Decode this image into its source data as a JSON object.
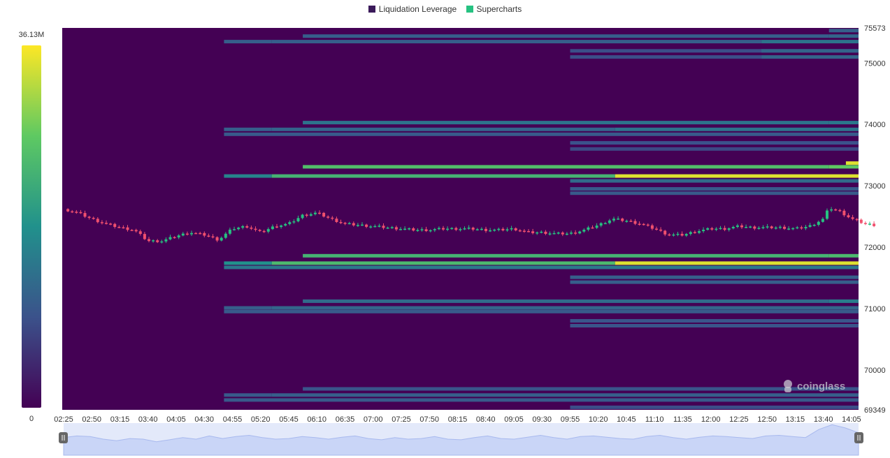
{
  "legend": {
    "items": [
      {
        "label": "Liquidation Leverage",
        "color": "#3b1a5a"
      },
      {
        "label": "Supercharts",
        "color": "#26c281"
      }
    ]
  },
  "colorbar": {
    "max_label": "36.13M",
    "min_label": "0",
    "stops": [
      "#440154",
      "#3b528b",
      "#21918c",
      "#5ec962",
      "#fde725"
    ]
  },
  "watermark": {
    "text": "coinglass",
    "icon": "coinglass-logo-icon"
  },
  "chart_data": {
    "type": "heatmap",
    "x_ticks": [
      "02:25",
      "02:50",
      "03:15",
      "03:40",
      "04:05",
      "04:30",
      "04:55",
      "05:20",
      "05:45",
      "06:10",
      "06:35",
      "07:00",
      "07:25",
      "07:50",
      "08:15",
      "08:40",
      "09:05",
      "09:30",
      "09:55",
      "10:20",
      "10:45",
      "11:10",
      "11:35",
      "12:00",
      "12:25",
      "12:50",
      "13:15",
      "13:40",
      "14:05"
    ],
    "y_ticks": [
      75573,
      75000,
      74000,
      73000,
      72000,
      71000,
      70000,
      69349
    ],
    "ylim": [
      69349,
      75573
    ],
    "colorscale_range": [
      0,
      36130000
    ],
    "background_value": 0,
    "bands": [
      {
        "price": 75530,
        "segments": [
          [
            27.2,
            28.8,
            0.3
          ]
        ]
      },
      {
        "price": 75440,
        "segments": [
          [
            8.5,
            27.2,
            0.3
          ],
          [
            27.2,
            28.8,
            0.33
          ]
        ]
      },
      {
        "price": 75350,
        "segments": [
          [
            5.7,
            7.4,
            0.3
          ],
          [
            7.4,
            24.8,
            0.3
          ],
          [
            24.8,
            28.8,
            0.38
          ]
        ]
      },
      {
        "price": 75200,
        "segments": [
          [
            18,
            28.8,
            0.24
          ],
          [
            24.8,
            28.8,
            0.32
          ]
        ]
      },
      {
        "price": 75100,
        "segments": [
          [
            18,
            24.8,
            0.24
          ],
          [
            24.8,
            28.8,
            0.32
          ]
        ]
      },
      {
        "price": 74100,
        "segments": [
          [
            28.3,
            28.8,
            0.45
          ]
        ]
      },
      {
        "price": 74030,
        "segments": [
          [
            8.5,
            27.2,
            0.38
          ],
          [
            27.2,
            28.8,
            0.4
          ]
        ]
      },
      {
        "price": 73920,
        "segments": [
          [
            5.7,
            7.4,
            0.3
          ],
          [
            7.4,
            19.6,
            0.32
          ],
          [
            19.6,
            28.8,
            0.38
          ]
        ]
      },
      {
        "price": 73840,
        "segments": [
          [
            5.7,
            28.8,
            0.28
          ]
        ]
      },
      {
        "price": 73700,
        "segments": [
          [
            18,
            28.8,
            0.25
          ]
        ]
      },
      {
        "price": 73600,
        "segments": [
          [
            18,
            28.8,
            0.22
          ]
        ]
      },
      {
        "price": 73370,
        "segments": [
          [
            27.8,
            28.8,
            0.95
          ]
        ]
      },
      {
        "price": 73310,
        "segments": [
          [
            8.5,
            27.2,
            0.7
          ],
          [
            27.2,
            28.8,
            0.75
          ]
        ]
      },
      {
        "price": 73160,
        "segments": [
          [
            5.7,
            7.4,
            0.45
          ],
          [
            7.4,
            19.6,
            0.65
          ],
          [
            19.6,
            28.8,
            0.95
          ]
        ]
      },
      {
        "price": 73080,
        "segments": [
          [
            18,
            28.8,
            0.35
          ]
        ]
      },
      {
        "price": 72950,
        "segments": [
          [
            18,
            28.8,
            0.28
          ]
        ]
      },
      {
        "price": 72880,
        "segments": [
          [
            18,
            28.8,
            0.28
          ]
        ]
      },
      {
        "price": 71950,
        "segments": [
          [
            28.3,
            28.8,
            0.6
          ]
        ]
      },
      {
        "price": 71860,
        "segments": [
          [
            8.5,
            27.2,
            0.65
          ],
          [
            27.2,
            28.8,
            0.68
          ]
        ]
      },
      {
        "price": 71740,
        "segments": [
          [
            5.7,
            7.4,
            0.5
          ],
          [
            7.4,
            19.6,
            0.68
          ],
          [
            19.6,
            28.8,
            0.95
          ]
        ]
      },
      {
        "price": 71670,
        "segments": [
          [
            5.7,
            28.8,
            0.4
          ]
        ]
      },
      {
        "price": 71510,
        "segments": [
          [
            18,
            28.8,
            0.3
          ]
        ]
      },
      {
        "price": 71430,
        "segments": [
          [
            18,
            28.8,
            0.3
          ]
        ]
      },
      {
        "price": 71190,
        "segments": [
          [
            28.3,
            28.8,
            0.4
          ]
        ]
      },
      {
        "price": 71120,
        "segments": [
          [
            8.5,
            27.2,
            0.35
          ],
          [
            27.2,
            28.8,
            0.42
          ]
        ]
      },
      {
        "price": 71010,
        "segments": [
          [
            5.7,
            7.4,
            0.3
          ],
          [
            7.4,
            28.8,
            0.33
          ]
        ]
      },
      {
        "price": 70950,
        "segments": [
          [
            5.7,
            28.8,
            0.28
          ]
        ]
      },
      {
        "price": 70800,
        "segments": [
          [
            18,
            28.8,
            0.26
          ]
        ]
      },
      {
        "price": 70720,
        "segments": [
          [
            18,
            28.8,
            0.26
          ]
        ]
      },
      {
        "price": 69690,
        "segments": [
          [
            8.5,
            28.8,
            0.26
          ]
        ]
      },
      {
        "price": 69590,
        "segments": [
          [
            5.7,
            7.4,
            0.28
          ],
          [
            7.4,
            28.8,
            0.3
          ]
        ]
      },
      {
        "price": 69510,
        "segments": [
          [
            5.7,
            28.8,
            0.28
          ]
        ]
      },
      {
        "price": 69390,
        "segments": [
          [
            18,
            28.8,
            0.24
          ]
        ]
      }
    ],
    "price_series": {
      "name": "Supercharts",
      "up_color": "#26c281",
      "down_color": "#f0506e",
      "points": [
        [
          0,
          72620
        ],
        [
          0.5,
          72560
        ],
        [
          1,
          72460
        ],
        [
          1.5,
          72380
        ],
        [
          2,
          72320
        ],
        [
          2.5,
          72280
        ],
        [
          3,
          72100
        ],
        [
          3.5,
          72100
        ],
        [
          4,
          72180
        ],
        [
          4.5,
          72240
        ],
        [
          5,
          72200
        ],
        [
          5.5,
          72120
        ],
        [
          6,
          72300
        ],
        [
          6.5,
          72340
        ],
        [
          7,
          72240
        ],
        [
          7.5,
          72340
        ],
        [
          8,
          72380
        ],
        [
          8.5,
          72520
        ],
        [
          9,
          72560
        ],
        [
          9.5,
          72460
        ],
        [
          10,
          72380
        ],
        [
          10.5,
          72360
        ],
        [
          11,
          72340
        ],
        [
          11.5,
          72320
        ],
        [
          12,
          72300
        ],
        [
          12.5,
          72280
        ],
        [
          13,
          72280
        ],
        [
          13.5,
          72300
        ],
        [
          14,
          72300
        ],
        [
          14.5,
          72300
        ],
        [
          15,
          72280
        ],
        [
          15.5,
          72280
        ],
        [
          16,
          72300
        ],
        [
          16.5,
          72240
        ],
        [
          17,
          72240
        ],
        [
          17.5,
          72220
        ],
        [
          18,
          72220
        ],
        [
          18.5,
          72280
        ],
        [
          19,
          72360
        ],
        [
          19.5,
          72460
        ],
        [
          20,
          72430
        ],
        [
          20.5,
          72380
        ],
        [
          21,
          72300
        ],
        [
          21.5,
          72200
        ],
        [
          22,
          72200
        ],
        [
          22.5,
          72260
        ],
        [
          23,
          72300
        ],
        [
          23.5,
          72300
        ],
        [
          24,
          72340
        ],
        [
          24.5,
          72320
        ],
        [
          25,
          72320
        ],
        [
          25.5,
          72320
        ],
        [
          26,
          72300
        ],
        [
          26.5,
          72340
        ],
        [
          27,
          72460
        ],
        [
          27.2,
          72640
        ],
        [
          27.6,
          72580
        ],
        [
          28,
          72460
        ],
        [
          28.5,
          72380
        ],
        [
          28.8,
          72360
        ]
      ]
    },
    "navigator_series": [
      0.55,
      0.6,
      0.58,
      0.5,
      0.45,
      0.52,
      0.5,
      0.42,
      0.48,
      0.55,
      0.5,
      0.6,
      0.52,
      0.58,
      0.62,
      0.55,
      0.5,
      0.52,
      0.58,
      0.55,
      0.5,
      0.56,
      0.6,
      0.52,
      0.48,
      0.55,
      0.5,
      0.52,
      0.58,
      0.5,
      0.48,
      0.55,
      0.6,
      0.52,
      0.5,
      0.56,
      0.62,
      0.55,
      0.5,
      0.58,
      0.6,
      0.56,
      0.52,
      0.5,
      0.58,
      0.62,
      0.55,
      0.5,
      0.56,
      0.6,
      0.58,
      0.55,
      0.52,
      0.6,
      0.62,
      0.58,
      0.55,
      0.8,
      0.95,
      0.85,
      0.7
    ]
  }
}
